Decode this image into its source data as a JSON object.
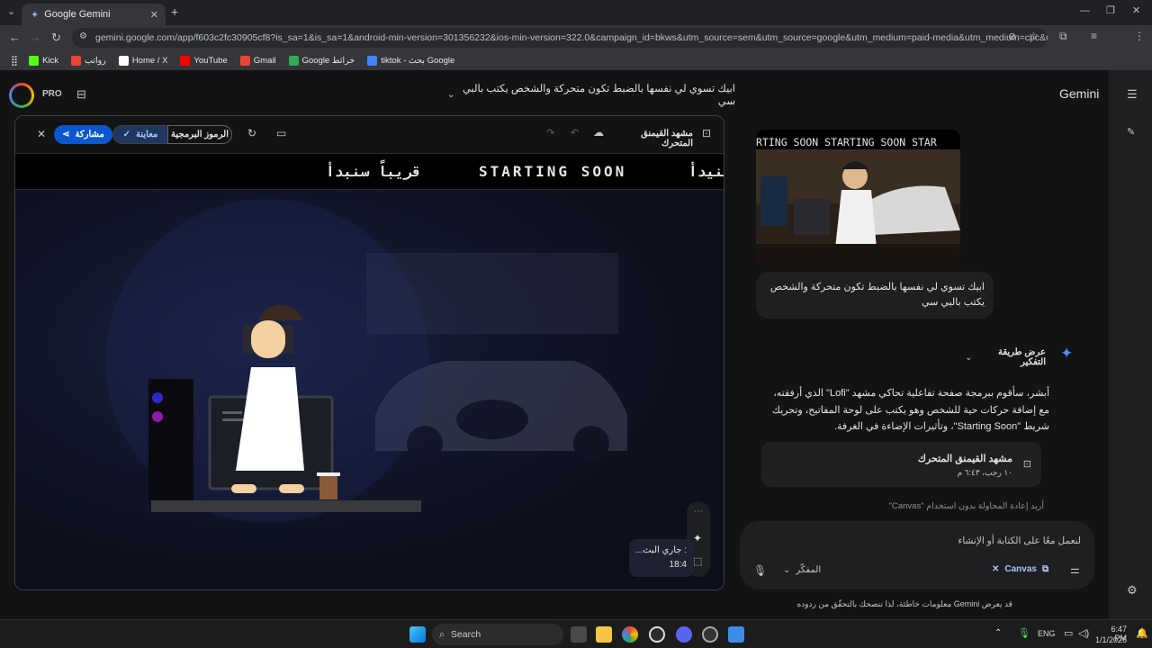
{
  "browser": {
    "tab_title": "Google Gemini",
    "url": "gemini.google.com/app/f603c2fc30905cf8?is_sa=1&is_sa=1&android-min-version=301356232&ios-min-version=322.0&campaign_id=bkws&utm_source=sem&utm_source=google&utm_medium=paid-media&utm_medium=cpc&utm_campai...",
    "bookmarks": [
      {
        "label": "Kick",
        "color": "#53fc18"
      },
      {
        "label": "رواتب",
        "color": "#ea4335"
      },
      {
        "label": "Home / X",
        "color": "#ffffff"
      },
      {
        "label": "YouTube",
        "color": "#ff0000"
      },
      {
        "label": "Gmail",
        "color": "#ea4335"
      },
      {
        "label": "Google خرائط",
        "color": "#34a853"
      },
      {
        "label": "tiktok - بحث Google",
        "color": "#4285f4"
      }
    ]
  },
  "header": {
    "pro_label": "PRO",
    "conversation_title": "ابيك تسوي لي نفسها بالضبط تكون متحركة والشخص يكتب بالبي سي",
    "brand": "Gemini"
  },
  "canvas": {
    "title": "مشهد القيمنق المتحرك",
    "code_tab": "الرموز البرمجية",
    "preview_tab": "معاينة",
    "share_label": "مشاركة",
    "marquee": [
      "سنيدأ",
      "STARTING SOON",
      "قريباً سنبدأ",
      "STARTING SOON",
      "قريباً سنبدأ"
    ],
    "status_line1": ": جاري البث...",
    "status_line2": "18:4"
  },
  "chat": {
    "thumb_marquee": "RTING SOON   STARTING SOON   STAR",
    "user_message": "ابيك تسوي لي نفسها بالضبط تكون متحركة والشخص يكتب بالبي سي",
    "thinking_label": "عرض طريقة التفكير",
    "response": "أبشر، سأقوم ببرمجة صفحة تفاعلية تحاكي مشهد \"Lofi\" الذي أرفقته، مع إضافة حركات حية للشخص وهو يكتب على لوحة المفاتيح، وتحريك شريط \"Starting Soon\"، وتأثيرات الإضاءة في الغرفة.",
    "card_title": "مشهد القيمنق المتحرك",
    "card_time": "١٠ رجب، ٦:٤٣ م",
    "retry_link": "أريد إعادة المحاولة بدون استخدام \"Canvas\"",
    "input_placeholder": "لنعمل معًا على الكتابة أو الإنشاء",
    "canvas_chip": "Canvas",
    "model_label": "المفكّر",
    "disclaimer": "قد يعرض Gemini معلومات خاطئة، لذا ننصحك بالتحقّق من ردوده"
  },
  "taskbar": {
    "search_label": "Search",
    "lang": "ENG",
    "time": "6:47 PM",
    "date": "1/1/2026"
  },
  "colors": {
    "accent_blue": "#a8c7fa",
    "share_btn": "#0b57d0",
    "page_bg": "#131314",
    "bubble_bg": "#1e1f20"
  }
}
